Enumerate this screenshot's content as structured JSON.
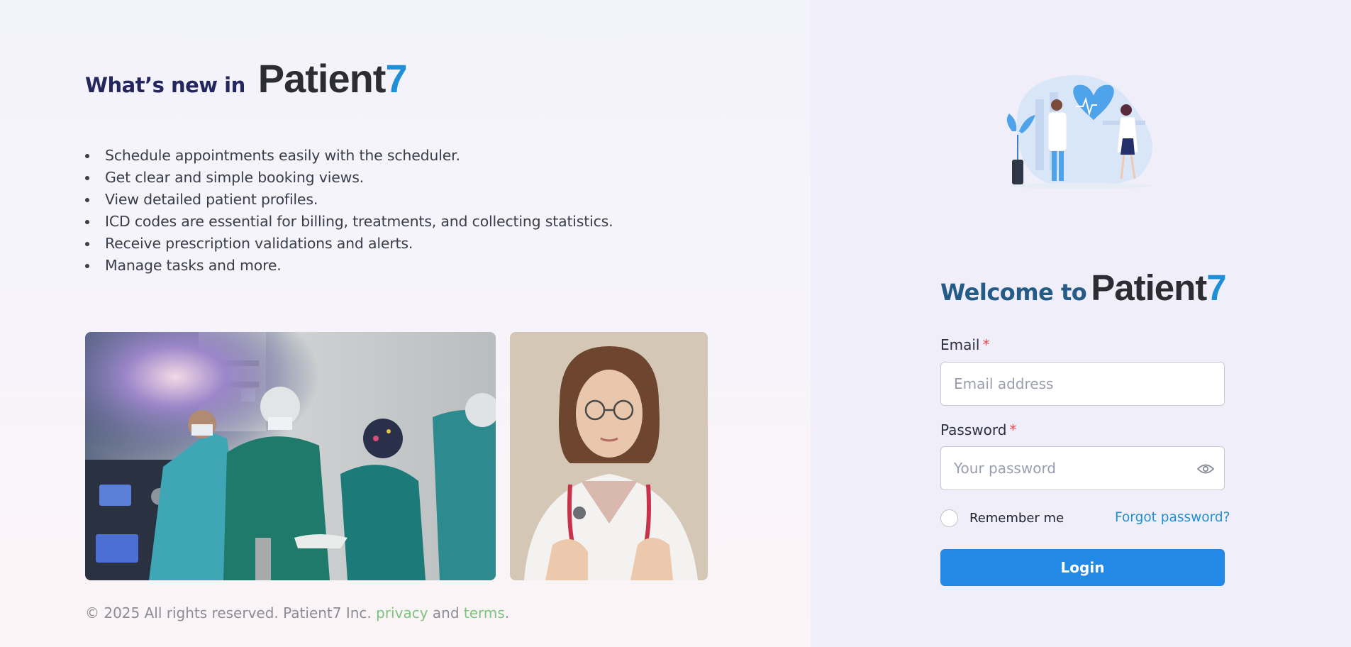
{
  "news": {
    "prefix": "What’s new in",
    "brand_main": "Patient",
    "brand_accent": "7",
    "features": [
      "Schedule appointments easily with the scheduler.",
      "Get clear and simple booking views.",
      "View detailed patient profiles.",
      "ICD codes are essential for billing, treatments, and collecting statistics.",
      "Receive prescription validations and alerts.",
      "Manage tasks and more."
    ]
  },
  "footer": {
    "copyright": "© 2025 All rights reserved. Patient7 Inc.",
    "privacy": "privacy",
    "and": "and",
    "terms": "terms",
    "period": "."
  },
  "login": {
    "welcome_prefix": "Welcome to",
    "brand_main": "Patient",
    "brand_accent": "7",
    "email_label": "Email",
    "email_placeholder": "Email address",
    "password_label": "Password",
    "password_placeholder": "Your password",
    "required_mark": "*",
    "remember_label": "Remember me",
    "forgot_label": "Forgot password?",
    "login_label": "Login"
  },
  "colors": {
    "brand_accent": "#1f8fd6",
    "primary_button": "#2389e6",
    "required": "#e5484d",
    "footer_link": "#7cc47f"
  },
  "icons": {
    "password_toggle": "eye-icon"
  }
}
